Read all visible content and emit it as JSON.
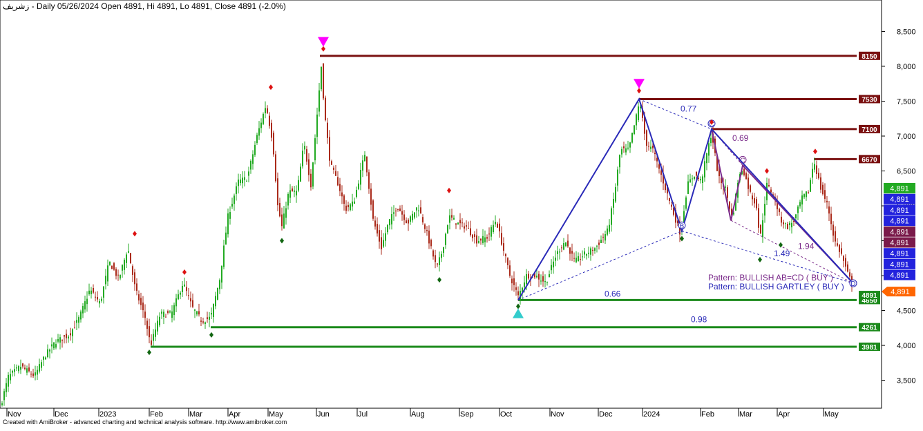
{
  "header": {
    "symbol": "زشريف",
    "title": "- Daily 05/26/2024 Open 4891, Hi 4891, Lo 4891, Close 4891 (-2.0%)"
  },
  "footer": {
    "credit": "Created with AmiBroker - advanced charting and technical analysis software. http://www.amibroker.com"
  },
  "colors": {
    "up": "#22aa22",
    "down": "#aa2a1a",
    "resistance": "#7a1010",
    "support": "#1b8a1b",
    "pattern_blue": "#2a2ab8",
    "pattern_purple": "#7a2a8a",
    "signal_magenta": "#ff00ff",
    "signal_cyan": "#33cccc",
    "price_tag": "#ff6600"
  },
  "chart_data": {
    "type": "candlestick",
    "ylim": [
      3100,
      8950
    ],
    "y_ticks": [
      "3,500",
      "4,000",
      "4,500",
      "5,000",
      "5,500",
      "6,000",
      "6,500",
      "7,000",
      "7,500",
      "8,000",
      "8,500"
    ],
    "y_tick_values": [
      3500,
      4000,
      4500,
      5000,
      5500,
      6000,
      6500,
      7000,
      7500,
      8000,
      8500
    ],
    "x_ticks": [
      "Nov",
      "Dec",
      "2023",
      "Feb",
      "Mar",
      "Apr",
      "May",
      "Jun",
      "Jul",
      "Aug",
      "Sep",
      "Oct",
      "Nov",
      "Dec",
      "2024",
      "Feb",
      "Mar",
      "Apr",
      "May"
    ],
    "price_path": [
      [
        0,
        3100
      ],
      [
        12,
        3550
      ],
      [
        30,
        3700
      ],
      [
        50,
        3560
      ],
      [
        65,
        3850
      ],
      [
        80,
        4050
      ],
      [
        100,
        4150
      ],
      [
        115,
        4400
      ],
      [
        130,
        4800
      ],
      [
        145,
        4600
      ],
      [
        158,
        5200
      ],
      [
        172,
        4950
      ],
      [
        185,
        5400
      ],
      [
        196,
        4800
      ],
      [
        210,
        4400
      ],
      [
        218,
        4000
      ],
      [
        232,
        4450
      ],
      [
        248,
        4450
      ],
      [
        265,
        4900
      ],
      [
        278,
        4550
      ],
      [
        292,
        4350
      ],
      [
        305,
        4400
      ],
      [
        318,
        4950
      ],
      [
        330,
        5850
      ],
      [
        345,
        6350
      ],
      [
        358,
        6400
      ],
      [
        372,
        7000
      ],
      [
        385,
        7450
      ],
      [
        395,
        6900
      ],
      [
        402,
        6000
      ],
      [
        408,
        5700
      ],
      [
        418,
        6200
      ],
      [
        430,
        6200
      ],
      [
        440,
        6900
      ],
      [
        450,
        6300
      ],
      [
        458,
        7200
      ],
      [
        465,
        8000
      ],
      [
        470,
        7300
      ],
      [
        478,
        6600
      ],
      [
        490,
        6300
      ],
      [
        500,
        5950
      ],
      [
        512,
        6050
      ],
      [
        528,
        6750
      ],
      [
        540,
        5800
      ],
      [
        552,
        5400
      ],
      [
        562,
        5750
      ],
      [
        575,
        6000
      ],
      [
        590,
        5750
      ],
      [
        605,
        6000
      ],
      [
        618,
        5600
      ],
      [
        632,
        5100
      ],
      [
        640,
        5350
      ],
      [
        650,
        5850
      ],
      [
        662,
        5750
      ],
      [
        675,
        5700
      ],
      [
        690,
        5500
      ],
      [
        705,
        5550
      ],
      [
        718,
        5800
      ],
      [
        728,
        5400
      ],
      [
        738,
        5000
      ],
      [
        750,
        4700
      ],
      [
        762,
        5000
      ],
      [
        775,
        5000
      ],
      [
        790,
        4900
      ],
      [
        805,
        5300
      ],
      [
        818,
        5500
      ],
      [
        832,
        5200
      ],
      [
        845,
        5300
      ],
      [
        862,
        5400
      ],
      [
        880,
        5650
      ],
      [
        890,
        6200
      ],
      [
        898,
        6800
      ],
      [
        910,
        6800
      ],
      [
        918,
        7150
      ],
      [
        926,
        7500
      ],
      [
        935,
        6900
      ],
      [
        945,
        6800
      ],
      [
        955,
        6500
      ],
      [
        968,
        6100
      ],
      [
        978,
        5800
      ],
      [
        985,
        5600
      ],
      [
        995,
        6300
      ],
      [
        1005,
        6450
      ],
      [
        1015,
        6350
      ],
      [
        1022,
        6700
      ],
      [
        1030,
        7050
      ],
      [
        1040,
        6400
      ],
      [
        1050,
        6250
      ],
      [
        1060,
        5800
      ],
      [
        1068,
        6350
      ],
      [
        1075,
        6550
      ],
      [
        1085,
        6200
      ],
      [
        1095,
        6000
      ],
      [
        1100,
        5500
      ],
      [
        1110,
        6300
      ],
      [
        1120,
        6150
      ],
      [
        1130,
        5800
      ],
      [
        1140,
        5700
      ],
      [
        1150,
        5800
      ],
      [
        1160,
        6100
      ],
      [
        1170,
        6200
      ],
      [
        1178,
        6650
      ],
      [
        1188,
        6250
      ],
      [
        1198,
        6000
      ],
      [
        1208,
        5500
      ],
      [
        1218,
        5300
      ],
      [
        1226,
        5050
      ],
      [
        1233,
        4891
      ]
    ],
    "levels": [
      {
        "label": "8150",
        "value": 8150,
        "kind": "resistance",
        "x_start": 463
      },
      {
        "label": "7530",
        "value": 7530,
        "kind": "resistance",
        "x_start": 925
      },
      {
        "label": "7100",
        "value": 7100,
        "kind": "resistance",
        "x_start": 1030
      },
      {
        "label": "6670",
        "value": 6670,
        "kind": "resistance",
        "x_start": 1178
      },
      {
        "label": "4650",
        "value": 4650,
        "kind": "support",
        "x_start": 750
      },
      {
        "label": "4261",
        "value": 4261,
        "kind": "support",
        "x_start": 305
      },
      {
        "label": "3981",
        "value": 3981,
        "kind": "support",
        "x_start": 218
      }
    ],
    "price_tags": [
      {
        "label": "4,891",
        "color": "#22aa22"
      },
      {
        "label": "4,891",
        "color": "#2222dd"
      },
      {
        "label": "4,891",
        "color": "#2222dd"
      },
      {
        "label": "4,891",
        "color": "#2222dd"
      },
      {
        "label": "4,891",
        "color": "#7a1a4a"
      },
      {
        "label": "4,891",
        "color": "#7a1a4a"
      },
      {
        "label": "4,891",
        "color": "#2222dd"
      },
      {
        "label": "4,891",
        "color": "#2222dd"
      },
      {
        "label": "4,891",
        "color": "#2222dd"
      }
    ],
    "last_price": {
      "label": "4891",
      "value": 4891,
      "bg": "#1b8a1b"
    },
    "current_price": {
      "label": "4,891",
      "value": 4891
    },
    "swing_highs": [
      [
        195,
        5600
      ],
      [
        267,
        5050
      ],
      [
        392,
        7700
      ],
      [
        468,
        8250
      ],
      [
        650,
        6220
      ],
      [
        925,
        7650
      ],
      [
        1030,
        7200
      ],
      [
        1110,
        6500
      ],
      [
        1180,
        6780
      ]
    ],
    "swing_lows": [
      [
        216,
        3900
      ],
      [
        306,
        4150
      ],
      [
        408,
        5500
      ],
      [
        636,
        4940
      ],
      [
        750,
        4560
      ],
      [
        987,
        5530
      ],
      [
        1100,
        5230
      ],
      [
        1130,
        5440
      ]
    ],
    "fractal_up_arrows": [
      [
        468,
        8340
      ],
      [
        925,
        7740
      ]
    ],
    "fractal_down_arrows": [
      [
        750,
        4470
      ]
    ],
    "patterns": [
      {
        "name": "Pattern: BULLISH AB=CD ( BUY )",
        "color": "#7a2a8a",
        "points": [
          [
            1030,
            7100
          ],
          [
            1058,
            5790
          ],
          [
            1075,
            6580
          ],
          [
            1235,
            4890
          ]
        ],
        "point_labels": [
          "",
          "",
          "C",
          "D"
        ],
        "ratios": [
          {
            "text": "0.69",
            "at": [
              1060,
              6930
            ]
          },
          {
            "text": "1.94",
            "at": [
              1155,
              5380
            ]
          }
        ]
      },
      {
        "name": "Pattern: BULLISH GARTLEY ( BUY )",
        "color": "#2a2ab8",
        "points": [
          [
            750,
            4650
          ],
          [
            925,
            7530
          ],
          [
            987,
            5640
          ],
          [
            1030,
            7100
          ],
          [
            1235,
            4890
          ]
        ],
        "point_labels": [
          "",
          "",
          "B",
          "C",
          "D"
        ],
        "ratios": [
          {
            "text": "0.77",
            "at": [
              985,
              7350
            ]
          },
          {
            "text": "0.66",
            "at": [
              875,
              4700
            ]
          },
          {
            "text": "1.49",
            "at": [
              1120,
              5280
            ]
          },
          {
            "text": "0.98",
            "at": [
              1000,
              4330
            ]
          }
        ]
      }
    ]
  }
}
